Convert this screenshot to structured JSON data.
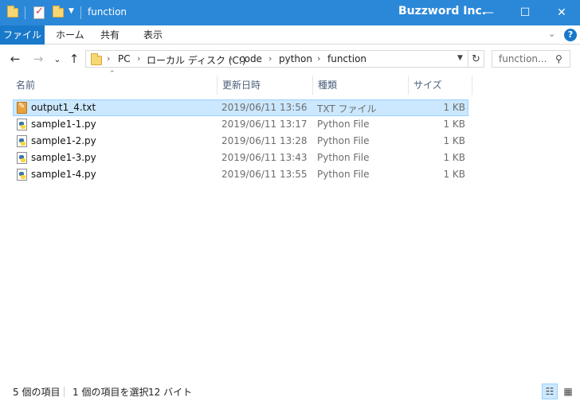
{
  "window": {
    "title": "function",
    "brand": "Buzzword Inc.",
    "minimize": "—",
    "maximize": "☐",
    "close": "✕"
  },
  "ribbon": {
    "tabs": [
      "ファイル",
      "ホーム",
      "共有",
      "表示"
    ],
    "collapse": "⌄",
    "help": "?"
  },
  "nav": {
    "back": "←",
    "forward": "→",
    "recent": "⌄",
    "up": "↑",
    "breadcrumb": [
      "PC",
      "ローカル ディスク (C:)",
      "code",
      "python",
      "function"
    ],
    "crumb_sep": "›",
    "refresh": "↻",
    "search_placeholder": "function...",
    "search_icon": "⚲"
  },
  "columns": {
    "name": "名前",
    "date": "更新日時",
    "type": "種類",
    "size": "サイズ"
  },
  "files": [
    {
      "name": "output1_4.txt",
      "date": "2019/06/11 13:56",
      "type": "TXT ファイル",
      "size": "1 KB",
      "icon": "text-file-icon",
      "selected": true
    },
    {
      "name": "sample1-1.py",
      "date": "2019/06/11 13:17",
      "type": "Python File",
      "size": "1 KB",
      "icon": "python-file-icon",
      "selected": false
    },
    {
      "name": "sample1-2.py",
      "date": "2019/06/11 13:28",
      "type": "Python File",
      "size": "1 KB",
      "icon": "python-file-icon",
      "selected": false
    },
    {
      "name": "sample1-3.py",
      "date": "2019/06/11 13:43",
      "type": "Python File",
      "size": "1 KB",
      "icon": "python-file-icon",
      "selected": false
    },
    {
      "name": "sample1-4.py",
      "date": "2019/06/11 13:55",
      "type": "Python File",
      "size": "1 KB",
      "icon": "python-file-icon",
      "selected": false
    }
  ],
  "status": {
    "item_count": "5 個の項目",
    "selection": "1 個の項目を選択",
    "selection_size": "12 バイト",
    "details_view": "☷",
    "icons_view": "▦"
  },
  "colors": {
    "titlebar": "#2b88d8",
    "file_tab": "#1979ca",
    "selection": "#cce8ff",
    "selection_border": "#99d1ff"
  }
}
